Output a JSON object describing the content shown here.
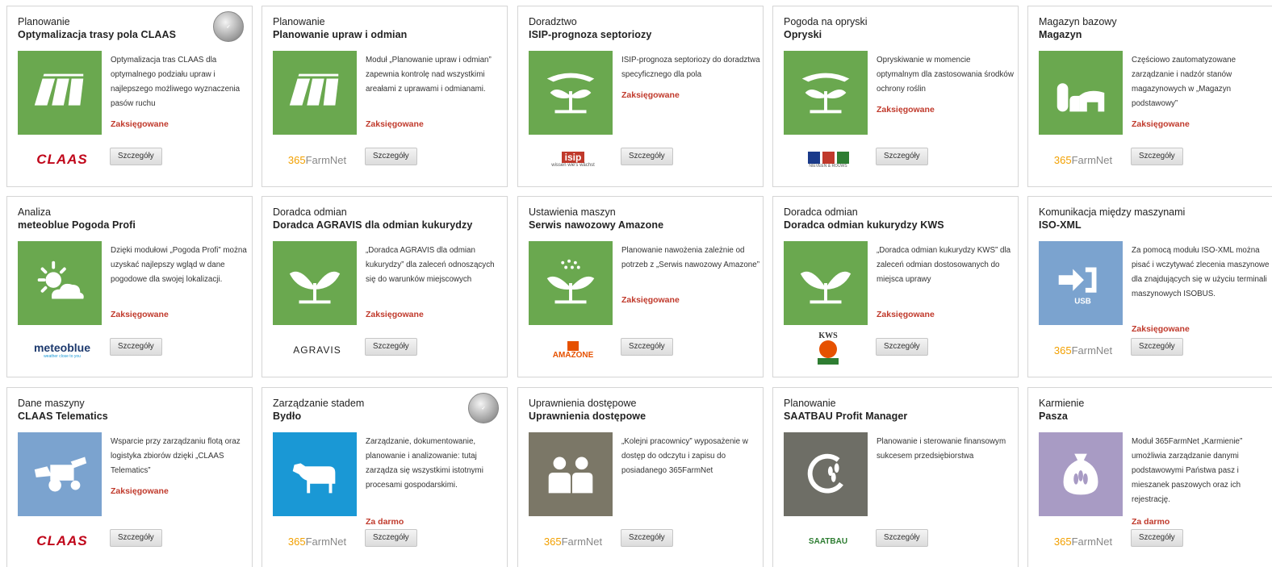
{
  "button_label": "Szczegóły",
  "status_booked": "Zaksięgowane",
  "status_free": "Za darmo",
  "cards": [
    {
      "category": "Planowanie",
      "title": "Optymalizacja trasy pola CLAAS",
      "desc": "Optymalizacja tras CLAAS dla optymalnego podziału upraw i najlepszego możliwego wyznaczenia pasów ruchu",
      "icon": "field-tracks-icon",
      "vendor": "CLAAS",
      "status": "Zaksięgowane"
    },
    {
      "category": "Planowanie",
      "title": "Planowanie upraw i odmian",
      "desc": "Moduł „Planowanie upraw i odmian” zapewnia kontrolę nad wszystkimi areałami z uprawami i odmianami.",
      "icon": "field-tracks-icon",
      "vendor_prefix": "365",
      "vendor_suffix": "FarmNet",
      "status": "Zaksięgowane"
    },
    {
      "category": "Doradztwo",
      "title": "ISIP-prognoza septoriozy",
      "desc": "ISIP-prognoza septoriozy do doradztwa specyficznego dla pola",
      "icon": "hand-plant-icon",
      "vendor": "isip",
      "vendor_sub": "wissen wie's wächst",
      "status": "Zaksięgowane"
    },
    {
      "category": "Pogoda na opryski",
      "title": "Opryski",
      "desc": "Opryskiwanie w momencie optymalnym dla zastosowania środków ochrony roślin",
      "icon": "hand-plant-icon",
      "vendor_sub": "NIEVEEN & ROUWS",
      "status": "Zaksięgowane"
    },
    {
      "category": "Magazyn bazowy",
      "title": "Magazyn",
      "desc": "Częściowo zautomatyzowane zarządzanie i nadzór stanów magazynowych w „Magazyn podstawowy”",
      "icon": "silo-barn-icon",
      "vendor_prefix": "365",
      "vendor_suffix": "FarmNet",
      "status": "Zaksięgowane"
    },
    {
      "category": "Analiza",
      "title": "meteoblue Pogoda Profi",
      "desc": "Dzięki modułowi „Pogoda Profi” można uzyskać najlepszy wgląd w dane pogodowe dla swojej lokalizacji.",
      "icon": "sun-cloud-icon",
      "vendor": "meteoblue",
      "vendor_sub": "weather close to you",
      "status": "Zaksięgowane"
    },
    {
      "category": "Doradca odmian",
      "title": "Doradca AGRAVIS dla odmian kukurydzy",
      "desc": "„Doradca AGRAVIS dla odmian kukurydzy” dla zaleceń odnoszących się do warunków miejscowych",
      "icon": "sprout-icon",
      "vendor": "AGRAVIS",
      "status": "Zaksięgowane"
    },
    {
      "category": "Ustawienia maszyn",
      "title": "Serwis nawozowy Amazone",
      "desc": "Planowanie nawożenia zależnie od potrzeb z „Serwis nawozowy Amazone”",
      "icon": "fertilizer-sprout-icon",
      "vendor": "AMAZONE",
      "status": "Zaksięgowane"
    },
    {
      "category": "Doradca odmian",
      "title": "Doradca odmian kukurydzy KWS",
      "desc": "„Doradca odmian kukurydzy KWS” dla zaleceń odmian dostosowanych do miejsca uprawy",
      "icon": "sprout-icon",
      "vendor": "KWS",
      "status": "Zaksięgowane"
    },
    {
      "category": "Komunikacja między maszynami",
      "title": "ISO-XML",
      "desc": "Za pomocą modułu ISO-XML można pisać i wczytywać zlecenia maszynowe dla znajdujących się w użyciu terminali maszynowych ISOBUS.",
      "icon": "usb-import-icon",
      "icon_text": "USB",
      "vendor_prefix": "365",
      "vendor_suffix": "FarmNet",
      "status": "Zaksięgowane"
    },
    {
      "category": "Dane maszyny",
      "title": "CLAAS Telematics",
      "desc": "Wsparcie przy zarządzaniu flotą oraz logistyka zbiorów dzięki „CLAAS Telematics”",
      "icon": "harvester-icon",
      "vendor": "CLAAS",
      "status": "Zaksięgowane"
    },
    {
      "category": "Zarządzanie stadem",
      "title": "Bydło",
      "desc": "Zarządzanie, dokumentowanie, planowanie i analizowanie: tutaj zarządza się wszystkimi istotnymi procesami gospodarskimi.",
      "icon": "cow-icon",
      "vendor_prefix": "365",
      "vendor_suffix": "FarmNet",
      "status": "Za darmo"
    },
    {
      "category": "Uprawnienia dostępowe",
      "title": "Uprawnienia dostępowe",
      "desc": "„Kolejni pracownicy” wyposażenie w dostęp do odczytu i zapisu do posiadanego 365FarmNet",
      "icon": "users-icon",
      "vendor_prefix": "365",
      "vendor_suffix": "FarmNet"
    },
    {
      "category": "Planowanie",
      "title": "SAATBAU Profit Manager",
      "desc": "Planowanie i sterowanie finansowym sukcesem przedsiębiorstwa",
      "icon": "grain-cycle-icon",
      "vendor": "SAATBAU"
    },
    {
      "category": "Karmienie",
      "title": "Pasza",
      "desc": "Moduł 365FarmNet „Karmienie” umożliwia zarządzanie danymi podstawowymi Państwa pasz i mieszanek paszowych oraz ich rejestrację.",
      "icon": "feed-bag-icon",
      "vendor_prefix": "365",
      "vendor_suffix": "FarmNet",
      "status": "Za darmo"
    }
  ]
}
